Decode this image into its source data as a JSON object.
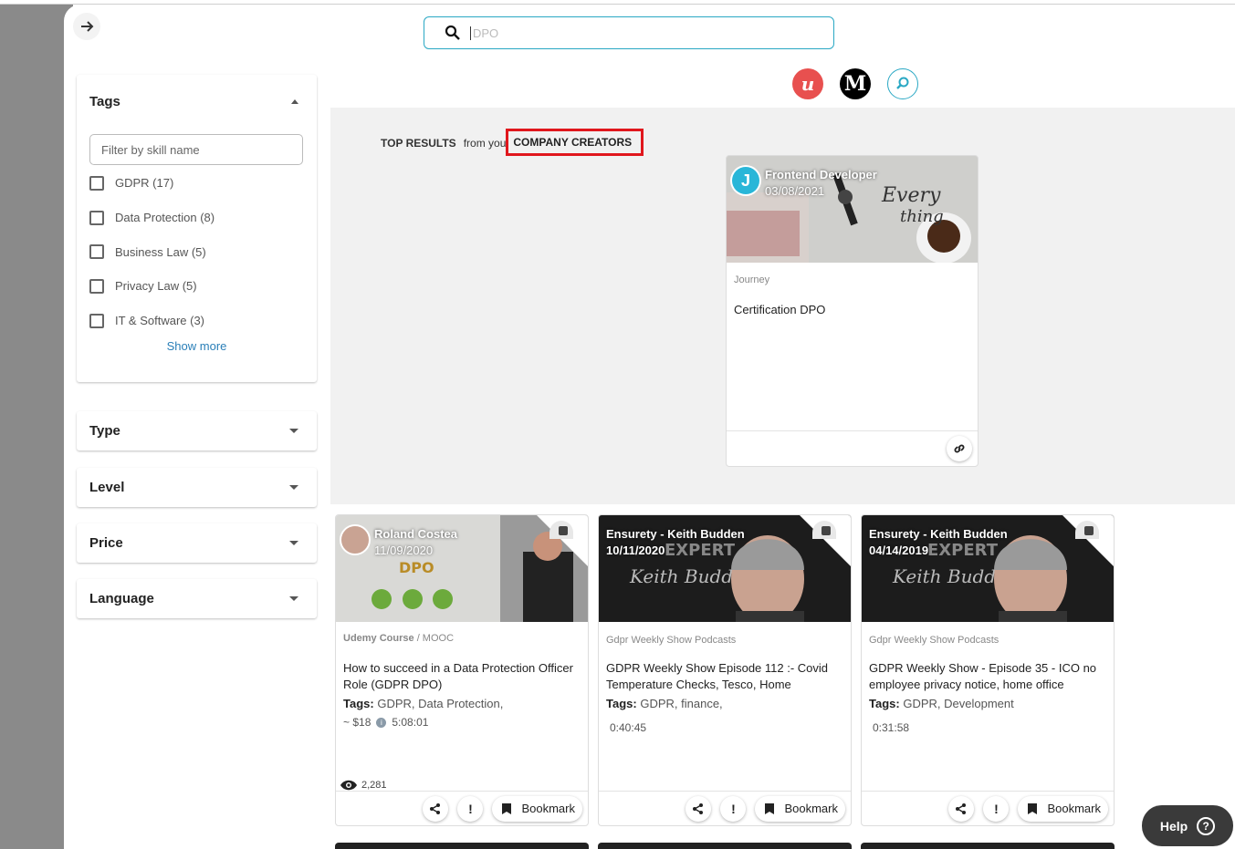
{
  "search": {
    "value": "",
    "placeholder": "DPO"
  },
  "sources": [
    "udemy-icon",
    "medium-icon",
    "find-icon"
  ],
  "sidebar": {
    "tags": {
      "title": "Tags",
      "filter_placeholder": "Filter by skill name",
      "items": [
        {
          "label": "GDPR (17)"
        },
        {
          "label": "Data Protection (8)"
        },
        {
          "label": "Business Law (5)"
        },
        {
          "label": "Privacy Law (5)"
        },
        {
          "label": "IT & Software (3)"
        }
      ],
      "show_more": "Show more"
    },
    "filters": [
      {
        "label": "Type"
      },
      {
        "label": "Level"
      },
      {
        "label": "Price"
      },
      {
        "label": "Language"
      }
    ]
  },
  "top_results": {
    "label": "TOP RESULTS",
    "from_you": "from you",
    "highlight": "COMPANY CREATORS",
    "card": {
      "author": "Frontend Developer",
      "date": "03/08/2021",
      "type": "Journey",
      "title": "Certification DPO"
    }
  },
  "results": [
    {
      "author": "Roland Costea",
      "date": "11/09/2020",
      "type": "Udemy Course",
      "type_extra": " / MOOC",
      "title": "How to succeed in a Data Protection Officer Role (GDPR DPO)",
      "tags_label": "Tags:",
      "tags": "GDPR, Data Protection,",
      "price": "~ $18",
      "duration": "5:08:01",
      "views": "2,281",
      "bookmark": "Bookmark"
    },
    {
      "author": "Ensurety - Keith Budden",
      "date": "10/11/2020",
      "type": "Gdpr Weekly Show",
      "type_extra": " Podcasts",
      "title": "GDPR Weekly Show Episode 112 :- Covid Temperature Checks, Tesco, Home",
      "tags_label": "Tags:",
      "tags": "GDPR, finance,",
      "duration": "0:40:45",
      "bookmark": "Bookmark"
    },
    {
      "author": "Ensurety - Keith Budden",
      "date": "04/14/2019",
      "type": "Gdpr Weekly Show",
      "type_extra": " Podcasts",
      "title": "GDPR Weekly Show - Episode 35 - ICO no employee privacy notice, home office",
      "tags_label": "Tags:",
      "tags": "GDPR, Development",
      "duration": "0:31:58",
      "bookmark": "Bookmark"
    }
  ],
  "thumb_text": {
    "dpo": "DPO",
    "expert": "EXPERT",
    "signature": "Keith Budden"
  },
  "help": {
    "label": "Help"
  }
}
